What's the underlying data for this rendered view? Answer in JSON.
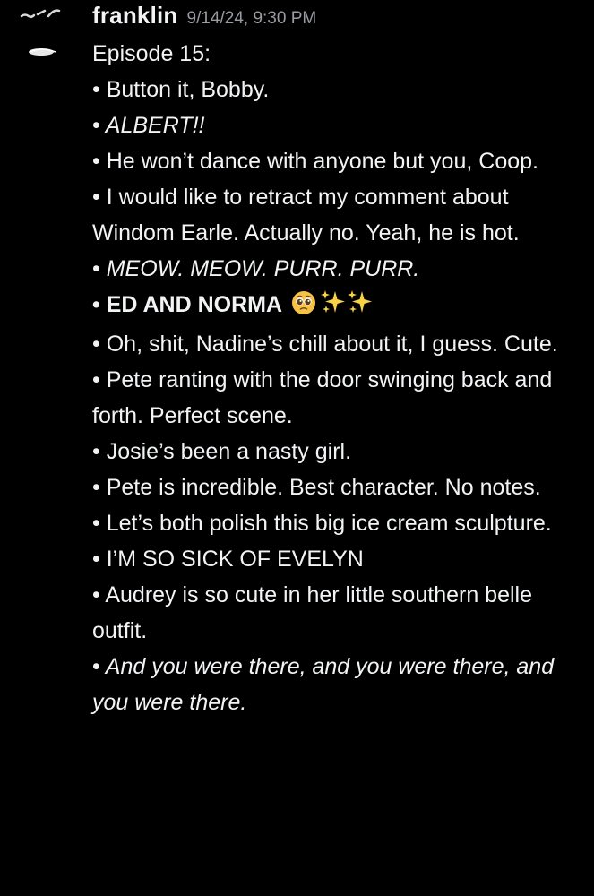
{
  "message": {
    "author": "franklin",
    "timestamp": "9/14/24, 9:30 PM",
    "heading": "Episode 15:",
    "bullet": "•",
    "items": [
      "Button it, Bobby.",
      "ALBERT!!",
      "He won’t dance with anyone but you, Coop.",
      "I would like to retract my comment about Windom Earle. Actually no. Yeah, he is hot.",
      "MEOW. MEOW. PURR. PURR.",
      "ED AND NORMA",
      "Oh, shit, Nadine’s chill about it, I guess. Cute.",
      "Pete ranting with the door swinging back and forth. Perfect scene.",
      "Josie’s been a nasty girl.",
      "Pete is incredible. Best character. No notes.",
      "Let’s both polish this big ice cream sculpture.",
      "I’M SO SICK OF EVELYN",
      "Audrey is so cute in her little southern belle outfit.",
      "And you were there, and you were there, and you were there."
    ],
    "emojis": [
      "pleading-face-icon",
      "sparkles-icon",
      "sparkles-icon"
    ]
  },
  "colors": {
    "background": "#000000",
    "text": "#f2f3f5",
    "timestamp": "#9a9ca3",
    "emoji_face": "#f7c244",
    "sparkle": "#f9d247"
  }
}
